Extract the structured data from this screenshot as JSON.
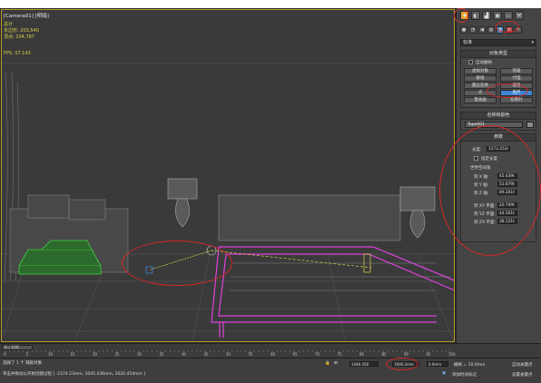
{
  "viewport": {
    "label": "[Camera01] [明暗]",
    "stats": {
      "title": "总计",
      "polys_label": "多边形:",
      "polys_value": "203,540",
      "verts_label": "顶点:",
      "verts_value": "204,787",
      "fps_label": "FPS:",
      "fps_value": "57.143"
    }
  },
  "command_panel": {
    "tabs": [
      {
        "name": "create",
        "glyph": "✹",
        "active": true
      },
      {
        "name": "modify",
        "glyph": "◐",
        "active": false
      },
      {
        "name": "hierarchy",
        "glyph": "▟",
        "active": false
      },
      {
        "name": "motion",
        "glyph": "◉",
        "active": false
      },
      {
        "name": "display",
        "glyph": "▭",
        "active": false
      },
      {
        "name": "utilities",
        "glyph": "⚒",
        "active": false
      }
    ],
    "sub_icons": [
      "●",
      "◔",
      "◀",
      "◍",
      "▮",
      "≋",
      "✎"
    ],
    "category_dropdown": "标准",
    "object_type": {
      "title": "对象类型",
      "autogrid_label": "自动栅格",
      "buttons": [
        {
          "label": "虚拟对象",
          "selected": false
        },
        {
          "label": "容器",
          "selected": false
        },
        {
          "label": "群组",
          "selected": false
        },
        {
          "label": "代理",
          "selected": false
        },
        {
          "label": "露出变换",
          "selected": false
        },
        {
          "label": "栅格",
          "selected": false
        },
        {
          "label": "点",
          "selected": false
        },
        {
          "label": "卷尺",
          "selected": true
        },
        {
          "label": "量角器",
          "selected": false
        },
        {
          "label": "指南针",
          "selected": false
        }
      ]
    },
    "name_color": {
      "title": "名称和颜色",
      "name_value": "Tape001"
    },
    "parameters": {
      "title": "参数",
      "length_label": "长度:",
      "length_value": "1572.253r",
      "specify_length_label": "指定长度",
      "world_space_label": "世界空间角",
      "rows": [
        {
          "label": "到 X 轴:",
          "value": "45.439t"
        },
        {
          "label": "到 Y 轴:",
          "value": "51.879t"
        },
        {
          "label": "到 Z 轴:",
          "value": "89.201t"
        },
        {
          "label": "到 XY 平面:",
          "value": "20.799t"
        },
        {
          "label": "到 YZ 平面:",
          "value": "44.561t"
        },
        {
          "label": "到 ZX 平面:",
          "value": "38.121t"
        }
      ]
    }
  },
  "timeline": {
    "slider": "0 / 100",
    "ticks": [
      "0",
      "5",
      "10",
      "15",
      "20",
      "25",
      "30",
      "35",
      "40",
      "45",
      "50",
      "55",
      "60",
      "65",
      "70",
      "75",
      "80",
      "85",
      "90",
      "95",
      "100"
    ]
  },
  "status_bar": {
    "selection": "选择了 1 个 辅助对象",
    "prompt": "单击并拖动以开始创建过程",
    "coords": "[ -2374.23mm, 1045.436mm, 2020.454mm ]",
    "x_value": "1446.458",
    "y_value": "1600.2mm",
    "z_value": "0.0mm",
    "grid": "栅格 = 10.0mm",
    "add_time_tag": "添加时间标记",
    "auto_key": "自动关键点",
    "set_key": "设置关键点",
    "colors": {
      "accent_blue": "#3f84d4",
      "active_tab": "#f0a02a",
      "annotation_red": "#d22828",
      "selection_magenta": "#e040e0",
      "mesh_green": "#3fd43f"
    }
  }
}
